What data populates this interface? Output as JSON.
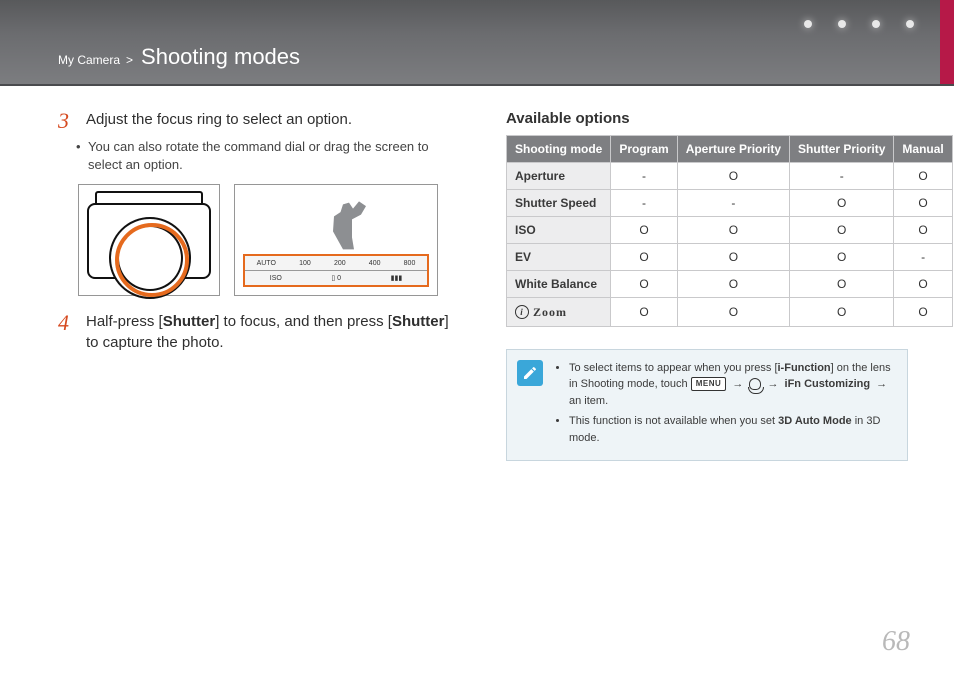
{
  "header": {
    "breadcrumb_prefix": "My Camera",
    "breadcrumb_sep": ">",
    "title": "Shooting modes"
  },
  "left": {
    "step3_num": "3",
    "step3_text": "Adjust the focus ring to select an option.",
    "step3_sub": "You can also rotate the command dial or drag the screen to select an option.",
    "scale_top": [
      "AUTO",
      "100",
      "200",
      "400",
      "800"
    ],
    "scale_bottom_label": "ISO",
    "scale_bottom_ev": "0",
    "step4_num": "4",
    "step4_text_1": "Half-press [",
    "step4_bold1": "Shutter",
    "step4_text_2": "] to focus, and then press [",
    "step4_bold2": "Shutter",
    "step4_text_3": "] to capture the photo."
  },
  "right": {
    "heading": "Available options",
    "cols": [
      "Shooting mode",
      "Program",
      "Aperture Priority",
      "Shutter Priority",
      "Manual"
    ],
    "rows": [
      {
        "label": "Aperture",
        "cells": [
          "-",
          "O",
          "-",
          "O"
        ]
      },
      {
        "label": "Shutter Speed",
        "cells": [
          "-",
          "-",
          "O",
          "O"
        ]
      },
      {
        "label": "ISO",
        "cells": [
          "O",
          "O",
          "O",
          "O"
        ]
      },
      {
        "label": "EV",
        "cells": [
          "O",
          "O",
          "O",
          "-"
        ]
      },
      {
        "label": "White Balance",
        "cells": [
          "O",
          "O",
          "O",
          "O"
        ]
      },
      {
        "label_zoom": "Zoom",
        "cells": [
          "O",
          "O",
          "O",
          "O"
        ]
      }
    ],
    "note1_a": "To select items to appear when you press [",
    "note1_bold1": "i-Function",
    "note1_b": "] on the lens in Shooting mode, touch ",
    "note1_menu": "MENU",
    "note1_arrow": "→",
    "note1_bold2": "iFn Customizing",
    "note1_c": " an item.",
    "note2_a": "This function is not available when you set ",
    "note2_bold1": "3D Auto Mode",
    "note2_b": " in 3D mode."
  },
  "pageNumber": "68"
}
